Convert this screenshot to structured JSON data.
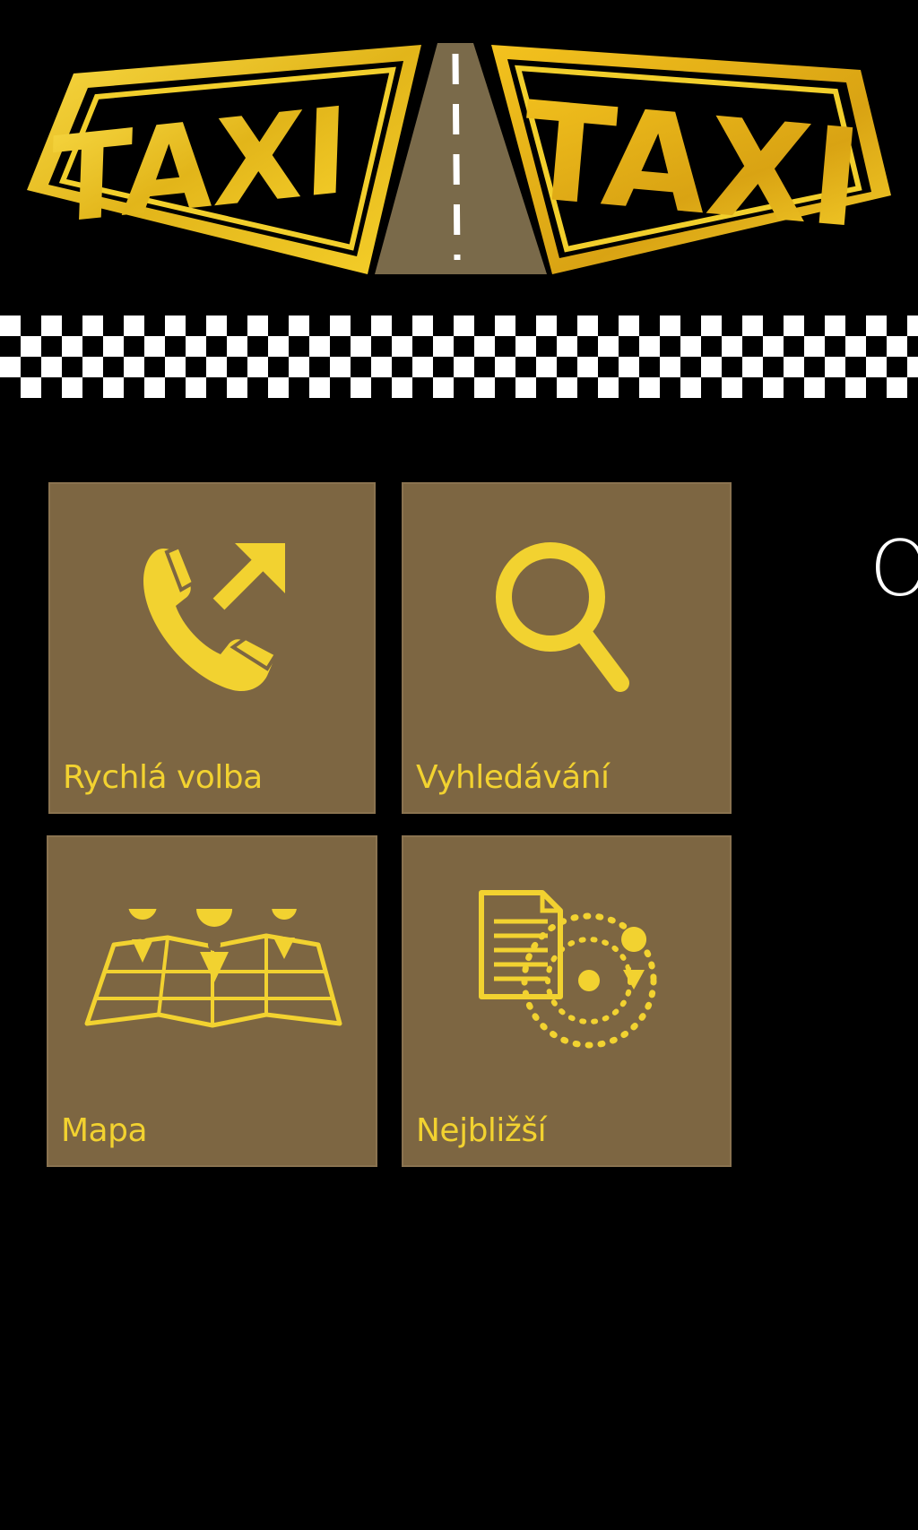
{
  "header": {
    "logo_left_text": "TAXI",
    "logo_right_text": "TAXI",
    "logo_icon": "taxi-road-logo"
  },
  "colors": {
    "background": "#000000",
    "tile": "#7d6642",
    "accent_yellow": "#f2d230",
    "road": "#7a6a4a"
  },
  "tiles": [
    {
      "label": "Rychlá volba",
      "icon": "phone-outgoing-icon"
    },
    {
      "label": "Vyhledávání",
      "icon": "search-icon"
    },
    {
      "label": "Mapa",
      "icon": "map-icon"
    },
    {
      "label": "Nejbližší",
      "icon": "nearby-icon"
    }
  ],
  "peek": {
    "text": "O"
  }
}
